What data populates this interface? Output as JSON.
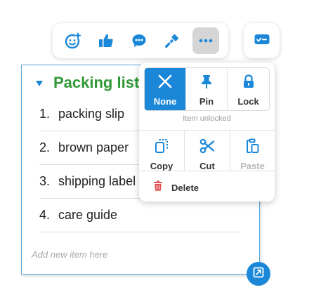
{
  "toolbar": {
    "buttons": [
      {
        "icon": "emoji-add-icon"
      },
      {
        "icon": "thumbs-up-icon"
      },
      {
        "icon": "comment-icon"
      },
      {
        "icon": "paint-brush-icon"
      },
      {
        "icon": "more-options-icon",
        "active": true
      }
    ],
    "side_button": {
      "icon": "checklist-card-icon"
    }
  },
  "card": {
    "title": "Packing list",
    "items": [
      {
        "number": "1.",
        "text": "packing slip"
      },
      {
        "number": "2.",
        "text": "brown paper"
      },
      {
        "number": "3.",
        "text": "shipping label"
      },
      {
        "number": "4.",
        "text": "care guide"
      }
    ],
    "add_placeholder": "Add new item here"
  },
  "menu": {
    "pin_options": [
      {
        "label": "None",
        "icon": "close-icon",
        "selected": true
      },
      {
        "label": "Pin",
        "icon": "pushpin-icon",
        "selected": false
      },
      {
        "label": "Lock",
        "icon": "padlock-icon",
        "selected": false
      }
    ],
    "lock_status": "Item unlocked",
    "clipboard": [
      {
        "label": "Copy",
        "icon": "copy-icon",
        "disabled": false
      },
      {
        "label": "Cut",
        "icon": "scissors-icon",
        "disabled": false
      },
      {
        "label": "Paste",
        "icon": "paste-icon",
        "disabled": true
      }
    ],
    "delete_label": "Delete"
  },
  "colors": {
    "accent_blue": "#1b87d8",
    "title_green": "#2f9a35",
    "delete_red": "#e05555"
  }
}
